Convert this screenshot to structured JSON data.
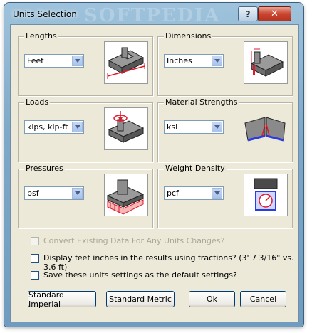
{
  "window": {
    "title": "Units Selection",
    "watermark": "SOFTPEDIA",
    "help_label": "?",
    "close_label": "✕"
  },
  "groups": [
    {
      "label": "Lengths",
      "value": "Feet",
      "icon": "slab-length-icon"
    },
    {
      "label": "Dimensions",
      "value": "Inches",
      "icon": "beam-dimension-icon"
    },
    {
      "label": "Loads",
      "value": "kips, kip-ft",
      "icon": "slab-load-icon"
    },
    {
      "label": "Material Strengths",
      "value": "ksi",
      "icon": "beam-strength-icon"
    },
    {
      "label": "Pressures",
      "value": "psf",
      "icon": "footing-pressure-icon"
    },
    {
      "label": "Weight Density",
      "value": "pcf",
      "icon": "scale-weight-icon"
    }
  ],
  "options": [
    {
      "label": "Convert Existing Data For Any Units Changes?",
      "checked": false,
      "enabled": false
    },
    {
      "label": "Display feet inches in the results using fractions? (3' 7 3/16\"  vs. 3.6 ft)",
      "checked": false,
      "enabled": true
    },
    {
      "label": "Save these units settings as the default settings?",
      "checked": false,
      "enabled": true
    }
  ],
  "buttons": {
    "imperial": "Standard Imperial",
    "metric": "Standard Metric",
    "ok": "Ok",
    "cancel": "Cancel"
  },
  "colors": {
    "accent_red": "#e0182a",
    "accent_blue": "#2a3ce0"
  }
}
